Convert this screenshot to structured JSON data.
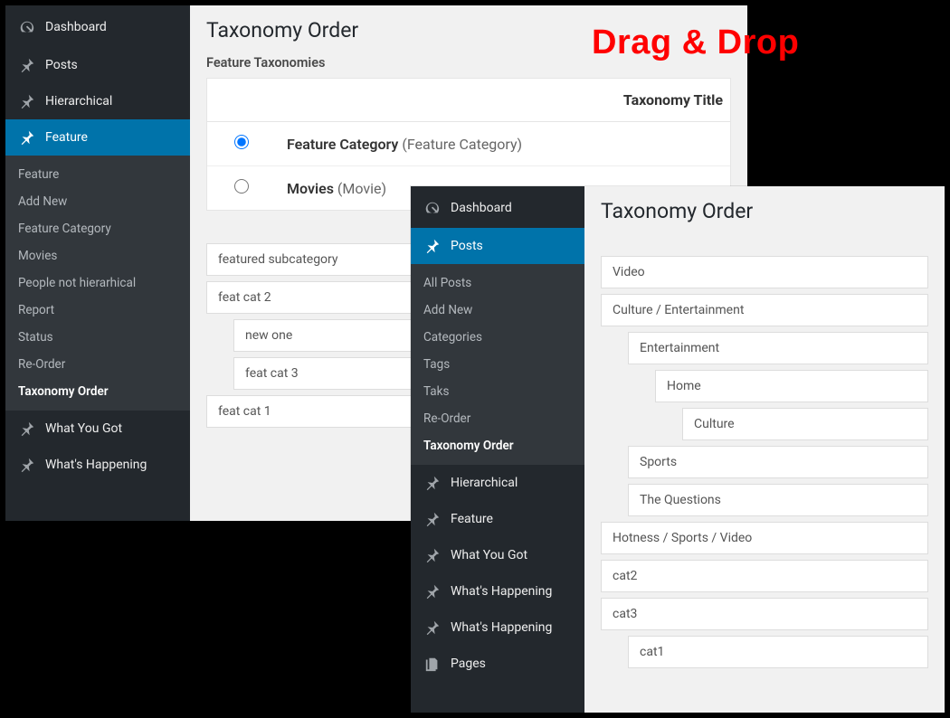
{
  "overlay_title": "Drag & Drop",
  "panel_a": {
    "sidebar": {
      "dashboard": "Dashboard",
      "items": [
        {
          "label": "Posts"
        },
        {
          "label": "Hierarchical"
        },
        {
          "label": "Feature"
        },
        {
          "label": "What You Got"
        },
        {
          "label": "What's Happening"
        }
      ],
      "submenu": {
        "items": [
          "Feature",
          "Add New",
          "Feature Category",
          "Movies",
          "People not hierarhical",
          "Report",
          "Status",
          "Re-Order",
          "Taxonomy Order"
        ]
      }
    },
    "content": {
      "title": "Taxonomy Order",
      "subhead": "Feature Taxonomies",
      "table_header": "Taxonomy Title",
      "rows": [
        {
          "main": "Feature Category",
          "paren": "(Feature Category)",
          "selected": true
        },
        {
          "main": "Movies",
          "paren": "(Movie)",
          "selected": false
        }
      ],
      "drag_items": {
        "a": "featured subcategory",
        "b": "feat cat 2",
        "b1": "new one",
        "b2": "feat cat 3",
        "c": "feat cat 1"
      }
    }
  },
  "panel_b": {
    "sidebar": {
      "dashboard": "Dashboard",
      "items_top": [
        {
          "label": "Posts"
        }
      ],
      "submenu": {
        "items": [
          "All Posts",
          "Add New",
          "Categories",
          "Tags",
          "Taks",
          "Re-Order",
          "Taxonomy Order"
        ]
      },
      "items_bottom": [
        {
          "label": "Hierarchical"
        },
        {
          "label": "Feature"
        },
        {
          "label": "What You Got"
        },
        {
          "label": "What's Happening"
        },
        {
          "label": "What's Happening"
        }
      ],
      "pages": "Pages"
    },
    "content": {
      "title": "Taxonomy Order",
      "drag": {
        "a": "Video",
        "b": "Culture / Entertainment",
        "b1": "Entertainment",
        "b1a": "Home",
        "b1a1": "Culture",
        "b2": "Sports",
        "b3": "The Questions",
        "c": "Hotness / Sports / Video",
        "d": "cat2",
        "e": "cat3",
        "e1": "cat1"
      }
    }
  }
}
